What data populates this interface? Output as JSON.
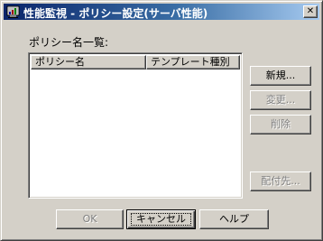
{
  "window": {
    "title": "性能監視 - ポリシー設定(サーバ性能)",
    "close_glyph": "✕"
  },
  "list": {
    "label": "ポリシー名一覧:",
    "columns": [
      "ポリシー名",
      "テンプレート種別"
    ],
    "rows": []
  },
  "side_buttons": {
    "new": "新規...",
    "edit": "変更...",
    "delete": "削除",
    "distribute": "配付先..."
  },
  "footer_buttons": {
    "ok": "OK",
    "cancel": "キャンセル",
    "help": "ヘルプ"
  },
  "icons": {
    "app": "monitor-chart-icon",
    "close": "close-icon"
  },
  "colors": {
    "titlebar_start": "#0a246a",
    "titlebar_end": "#a6caf0",
    "face": "#d4d0c8"
  }
}
